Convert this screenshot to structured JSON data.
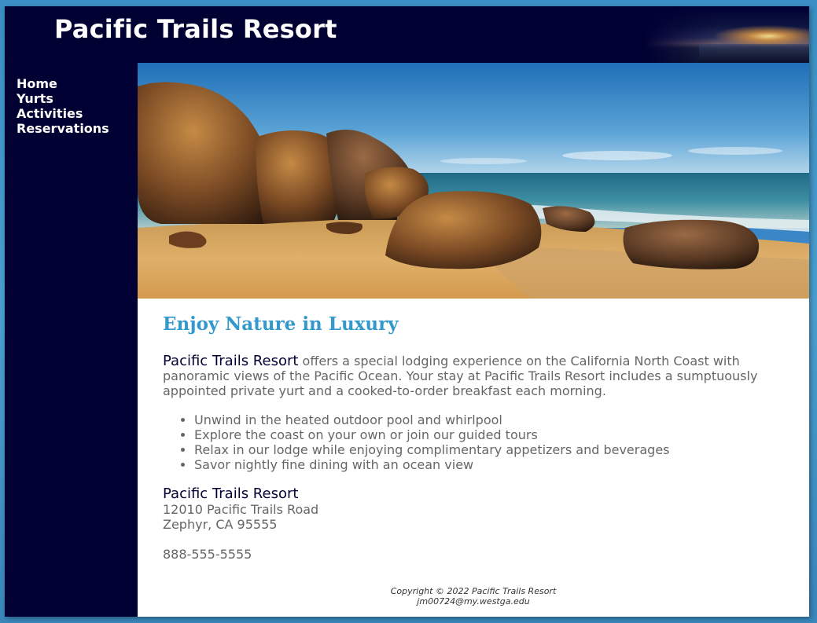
{
  "header": {
    "title": "Pacific Trails Resort"
  },
  "nav": {
    "items": [
      {
        "label": "Home"
      },
      {
        "label": "Yurts"
      },
      {
        "label": "Activities"
      },
      {
        "label": "Reservations"
      }
    ]
  },
  "main": {
    "heading": "Enjoy Nature in Luxury",
    "intro": {
      "resort": "Pacific Trails Resort",
      "text": " offers a special lodging experience on the California North Coast with panoramic views of the Pacific Ocean. Your stay at Pacific Trails Resort includes a sumptuously appointed private yurt and a cooked-to-order breakfast each morning."
    },
    "features": [
      "Unwind in the heated outdoor pool and whirlpool",
      "Explore the coast on your own or join our guided tours",
      "Relax in our lodge while enjoying complimentary appetizers and beverages",
      "Savor nightly fine dining with an ocean view"
    ],
    "contact": {
      "name": "Pacific Trails Resort",
      "street": "12010 Pacific Trails Road",
      "city": "Zephyr, CA 95555",
      "phone": "888-555-5555"
    }
  },
  "footer": {
    "copyright": "Copyright © 2022 Pacific Trails Resort",
    "email": "jm00724@my.westga.edu"
  },
  "colors": {
    "background": "#3b8fc4",
    "wrapper": "#000033",
    "heading": "#3399cc",
    "text": "#666666"
  }
}
